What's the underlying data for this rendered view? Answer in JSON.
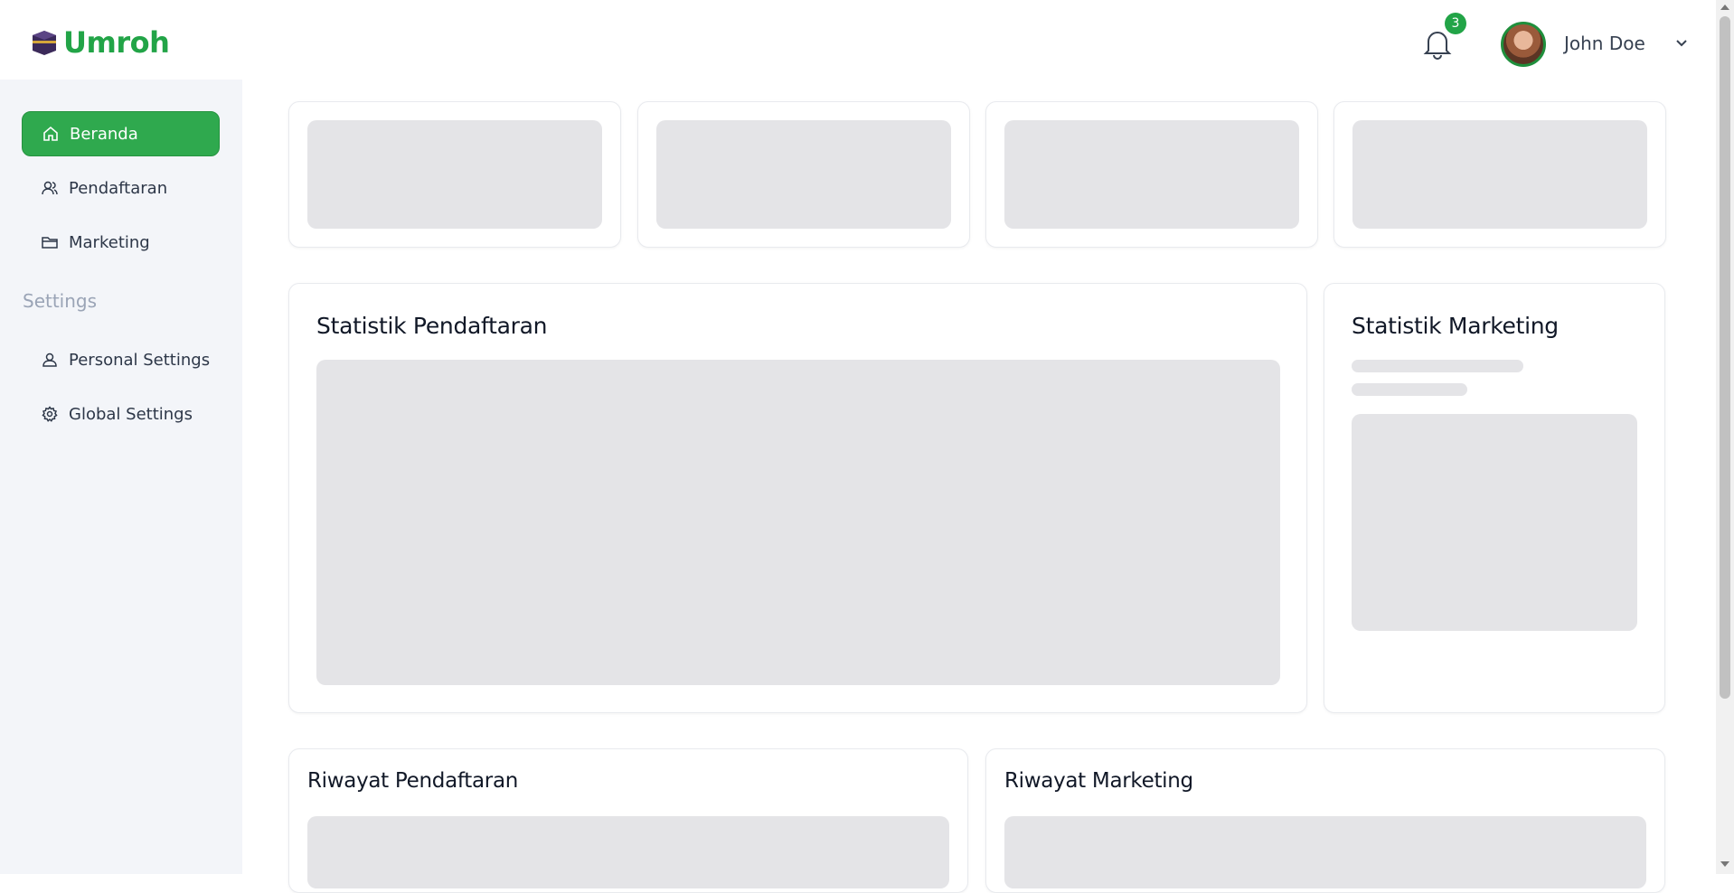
{
  "app": {
    "name": "Umroh",
    "brand_color": "#22a447"
  },
  "header": {
    "notifications": {
      "icon": "bell-icon",
      "count": "3"
    },
    "user": {
      "name": "John Doe",
      "avatar": "avatar"
    }
  },
  "sidebar": {
    "items": [
      {
        "label": "Beranda",
        "icon": "home-icon",
        "active": true
      },
      {
        "label": "Pendaftaran",
        "icon": "users-icon",
        "active": false
      },
      {
        "label": "Marketing",
        "icon": "folder-icon",
        "active": false
      }
    ],
    "settings_label": "Settings",
    "settings_items": [
      {
        "label": "Personal Settings",
        "icon": "user-icon"
      },
      {
        "label": "Global Settings",
        "icon": "gear-icon"
      }
    ]
  },
  "main": {
    "stat_reg_title": "Statistik Pendaftaran",
    "stat_mkt_title": "Statistik Marketing",
    "hist_reg_title": "Riwayat Pendaftaran",
    "hist_mkt_title": "Riwayat Marketing"
  }
}
